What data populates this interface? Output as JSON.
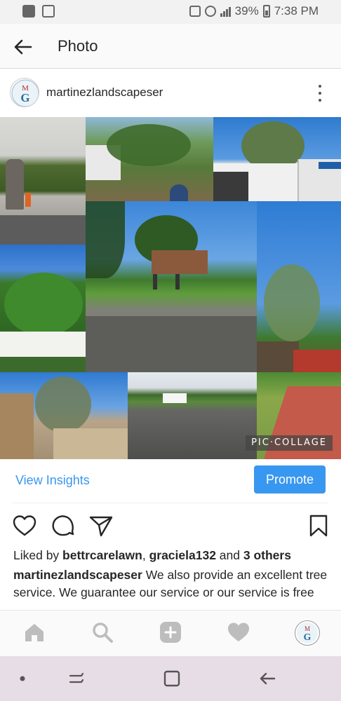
{
  "status_bar": {
    "battery": "39%",
    "time": "7:38 PM"
  },
  "header": {
    "title": "Photo",
    "back_icon": "back-arrow-icon"
  },
  "post": {
    "username": "martinezlandscapeser",
    "avatar_letters": "MG",
    "watermark": "PIC·COLLAGE"
  },
  "insights": {
    "view_label": "View Insights",
    "promote_label": "Promote"
  },
  "likes": {
    "prefix": "Liked by ",
    "user1": "bettrcarelawn",
    "sep": ", ",
    "user2": "graciela132",
    "and": " and ",
    "others": "3 others"
  },
  "caption": {
    "username": "martinezlandscapeser",
    "text": " We also provide an excellent tree service. We guarantee our service or our service is free"
  },
  "colors": {
    "accent": "#3897f0",
    "nav_bar": "#e7dde6"
  }
}
